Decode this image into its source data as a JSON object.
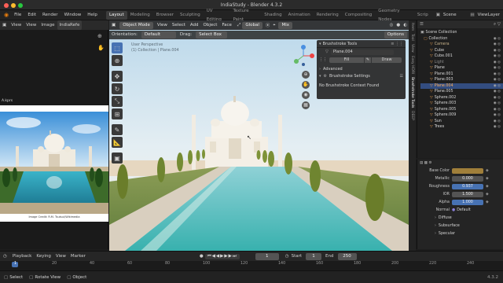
{
  "window": {
    "title": "IndiaStudy - Blender 4.3.2"
  },
  "menubar": {
    "menus": [
      "File",
      "Edit",
      "Render",
      "Window",
      "Help"
    ],
    "workspaces": [
      "Layout",
      "Modeling",
      "Browser",
      "Sculpting",
      "UV Editing",
      "Texture Paint",
      "Shading",
      "Animation",
      "Rendering",
      "Compositing",
      "Geometry Nodes",
      "Scrip"
    ],
    "scene": "Scene",
    "view_layer": "ViewLayer"
  },
  "image_editor": {
    "view": "View",
    "view2": "View",
    "image": "Image",
    "image_name": "IndiaRefe",
    "ref_label": "A.kprs",
    "caption": "Image Credit: R.M. Tsutsui/Wikimedia"
  },
  "viewport": {
    "mode": "Object Mode",
    "menus": [
      "View",
      "Select",
      "Add",
      "Object",
      "Face"
    ],
    "transform": "Global",
    "shading": "Mix",
    "orientation_label": "Orientation:",
    "orientation_value": "Default",
    "drag_label": "Drag:",
    "drag_value": "Select Box",
    "options": "Options",
    "overlay_line1": "User Perspective",
    "overlay_line2": "(1) Collection | Plane.004"
  },
  "brushstroke_panel": {
    "title": "Brushstroke Tools",
    "object": "Plane.004",
    "fill": "Fill",
    "draw": "Draw",
    "advanced": "Advanced",
    "settings": "Brushstroke Settings",
    "context": "No Brushstroke Context Found"
  },
  "side_tabs": [
    "Item",
    "Tool",
    "View",
    "Easy HDRI",
    "Brushstroke Tools",
    "DEEP"
  ],
  "outliner": {
    "title": "Scene Collection",
    "items": [
      {
        "name": "Collection",
        "color": "#d8d8d8"
      },
      {
        "name": "Camera",
        "color": "#c8b38a"
      },
      {
        "name": "Cube",
        "color": "#d8d8d8"
      },
      {
        "name": "Cube.001",
        "color": "#d8d8d8"
      },
      {
        "name": "Light",
        "color": "#8a8a8a"
      },
      {
        "name": "Plane",
        "color": "#d8d8d8"
      },
      {
        "name": "Plane.001",
        "color": "#d8d8d8"
      },
      {
        "name": "Plane.003",
        "color": "#d8d8d8"
      },
      {
        "name": "Plane.004",
        "color": "#ffb05a"
      },
      {
        "name": "Plane.005",
        "color": "#d8d8d8"
      },
      {
        "name": "Sphere.002",
        "color": "#d8d8d8"
      },
      {
        "name": "Sphere.003",
        "color": "#d8d8d8"
      },
      {
        "name": "Sphere.005",
        "color": "#d8d8d8"
      },
      {
        "name": "Sphere.009",
        "color": "#d8d8d8"
      },
      {
        "name": "Sun",
        "color": "#d8d8d8"
      },
      {
        "name": "Trees",
        "color": "#d8d8d8"
      }
    ]
  },
  "properties": {
    "base_color_label": "Base Color",
    "base_color": "#a07f3a",
    "metallic_label": "Metallic",
    "metallic": "0.000",
    "roughness_label": "Roughness",
    "roughness": "0.937",
    "ior_label": "IOR",
    "ior": "1.500",
    "alpha_label": "Alpha",
    "alpha": "1.000",
    "normal_label": "Normal",
    "normal": "Default",
    "sections": [
      "Diffuse",
      "Subsurface",
      "Specular"
    ]
  },
  "timeline": {
    "playback": "Playback",
    "keying": "Keying",
    "view": "View",
    "marker": "Marker",
    "current_frame": "1",
    "start_label": "Start",
    "start": "1",
    "end_label": "End",
    "end": "250",
    "ticks": [
      "1",
      "20",
      "40",
      "60",
      "80",
      "100",
      "120",
      "140",
      "160",
      "180",
      "200",
      "220",
      "240"
    ]
  },
  "statusbar": {
    "select": "Select",
    "rotate": "Rotate View",
    "object": "Object",
    "version": "4.3.2"
  },
  "accent": "#4772b3"
}
